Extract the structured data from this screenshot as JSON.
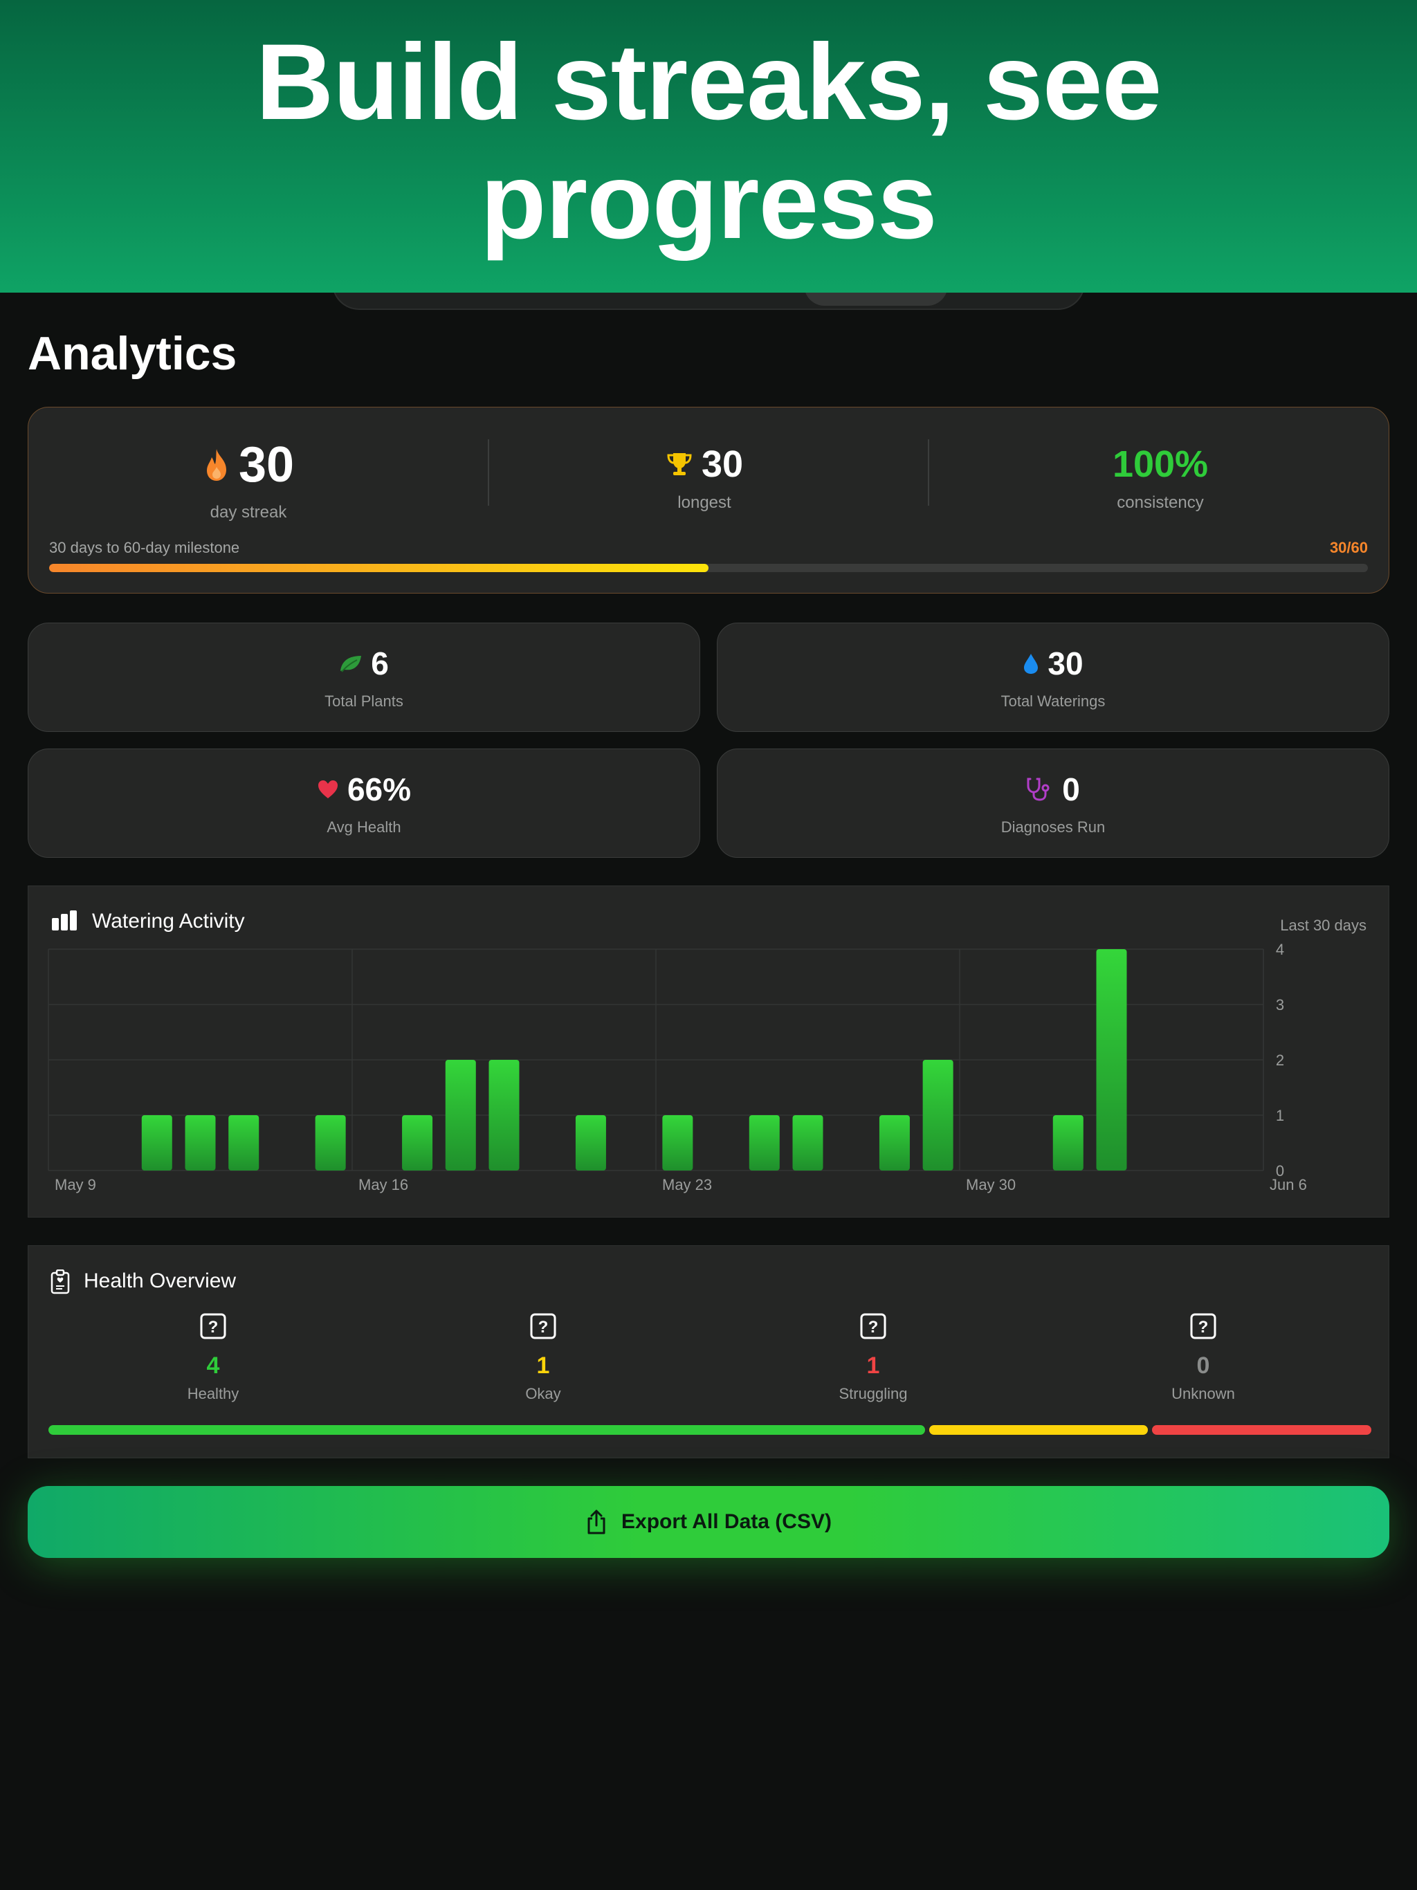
{
  "hero": {
    "headline": "Build streaks, see progress"
  },
  "page": {
    "title": "Analytics"
  },
  "streak": {
    "current_value": "30",
    "current_label": "day streak",
    "longest_value": "30",
    "longest_label": "longest",
    "consistency_value": "100%",
    "consistency_label": "consistency",
    "milestone_text": "30 days to 60-day milestone",
    "milestone_count": "30/60",
    "milestone_progress": 0.5
  },
  "stats": {
    "plants": {
      "value": "6",
      "label": "Total Plants"
    },
    "waterings": {
      "value": "30",
      "label": "Total Waterings"
    },
    "health": {
      "value": "66%",
      "label": "Avg Health"
    },
    "diagnoses": {
      "value": "0",
      "label": "Diagnoses Run"
    }
  },
  "watering_chart": {
    "title": "Watering Activity",
    "subtitle": "Last 30 days"
  },
  "chart_data": {
    "type": "bar",
    "title": "Watering Activity",
    "categories": [
      "May 9",
      "May 10",
      "May 11",
      "May 12",
      "May 13",
      "May 14",
      "May 15",
      "May 16",
      "May 17",
      "May 18",
      "May 19",
      "May 20",
      "May 21",
      "May 22",
      "May 23",
      "May 24",
      "May 25",
      "May 26",
      "May 27",
      "May 28",
      "May 29",
      "May 30",
      "May 31",
      "Jun 1",
      "Jun 2",
      "Jun 3",
      "Jun 4",
      "Jun 5",
      "Jun 6",
      "Jun 7"
    ],
    "values": [
      0,
      0,
      1,
      1,
      1,
      0,
      1,
      0,
      1,
      2,
      2,
      0,
      1,
      0,
      1,
      0,
      1,
      1,
      0,
      1,
      2,
      0,
      0,
      1,
      4,
      0,
      0,
      0,
      0,
      0
    ],
    "x_tick_labels": [
      "May 9",
      "May 16",
      "May 23",
      "May 30",
      "Jun 6"
    ],
    "y_tick_labels": [
      "0",
      "1",
      "2",
      "3",
      "4"
    ],
    "ylim": [
      0,
      4
    ],
    "grid": true,
    "bar_color": "#2fcc3a"
  },
  "health_overview": {
    "title": "Health Overview",
    "categories": [
      {
        "value": "4",
        "label": "Healthy",
        "color": "#2fcc3a",
        "fraction": 0.6667
      },
      {
        "value": "1",
        "label": "Okay",
        "color": "#fdd40a",
        "fraction": 0.1667
      },
      {
        "value": "1",
        "label": "Struggling",
        "color": "#f04444",
        "fraction": 0.1667
      },
      {
        "value": "0",
        "label": "Unknown",
        "color": "#8a8c8b",
        "fraction": 0
      }
    ]
  },
  "export": {
    "label": "Export All Data (CSV)"
  },
  "colors": {
    "accent_green": "#2fcc3a",
    "streak_orange": "#f7862b",
    "trophy_yellow": "#f5c400",
    "water_blue": "#1a8cf0",
    "heart_red": "#e8334a",
    "diagnose_purple": "#b13ec8"
  }
}
